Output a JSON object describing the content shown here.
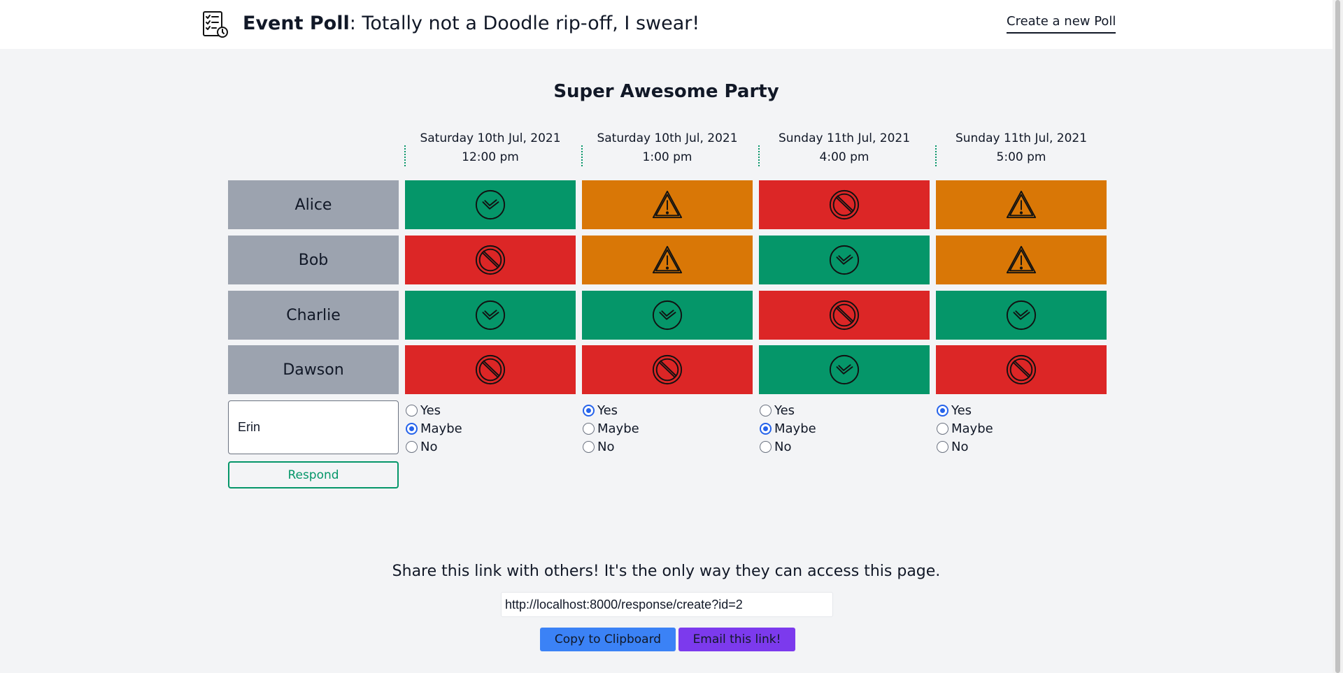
{
  "header": {
    "brand_bold": "Event Poll",
    "brand_rest": ": Totally not a Doodle rip-off, I swear!",
    "brand_icon": "checklist-clock-icon",
    "new_poll_link": "Create a new Poll"
  },
  "poll": {
    "title": "Super Awesome Party",
    "columns": [
      {
        "date": "Saturday 10th Jul, 2021",
        "time": "12:00 pm"
      },
      {
        "date": "Saturday 10th Jul, 2021",
        "time": "1:00 pm"
      },
      {
        "date": "Sunday 11th Jul, 2021",
        "time": "4:00 pm"
      },
      {
        "date": "Sunday 11th Jul, 2021",
        "time": "5:00 pm"
      }
    ],
    "responses": [
      {
        "name": "Alice",
        "answers": [
          "yes",
          "maybe",
          "no",
          "maybe"
        ]
      },
      {
        "name": "Bob",
        "answers": [
          "no",
          "maybe",
          "yes",
          "maybe"
        ]
      },
      {
        "name": "Charlie",
        "answers": [
          "yes",
          "yes",
          "no",
          "yes"
        ]
      },
      {
        "name": "Dawson",
        "answers": [
          "no",
          "no",
          "yes",
          "no"
        ]
      }
    ],
    "colors": {
      "yes": "#059669",
      "maybe": "#d97706",
      "no": "#dc2626",
      "name_cell": "#9ca3af"
    },
    "icons": {
      "yes": "check-circle-icon",
      "maybe": "warning-triangle-icon",
      "no": "prohibited-icon"
    }
  },
  "new_response": {
    "name_value": "Erin",
    "option_labels": [
      "Yes",
      "Maybe",
      "No"
    ],
    "selected": [
      "Maybe",
      "Yes",
      "Maybe",
      "Yes"
    ],
    "respond_button": "Respond"
  },
  "share": {
    "text": "Share this link with others! It's the only way they can access this page.",
    "link": "http://localhost:8000/response/create?id=2",
    "copy_button": "Copy to Clipboard",
    "email_button": "Email this link!"
  }
}
